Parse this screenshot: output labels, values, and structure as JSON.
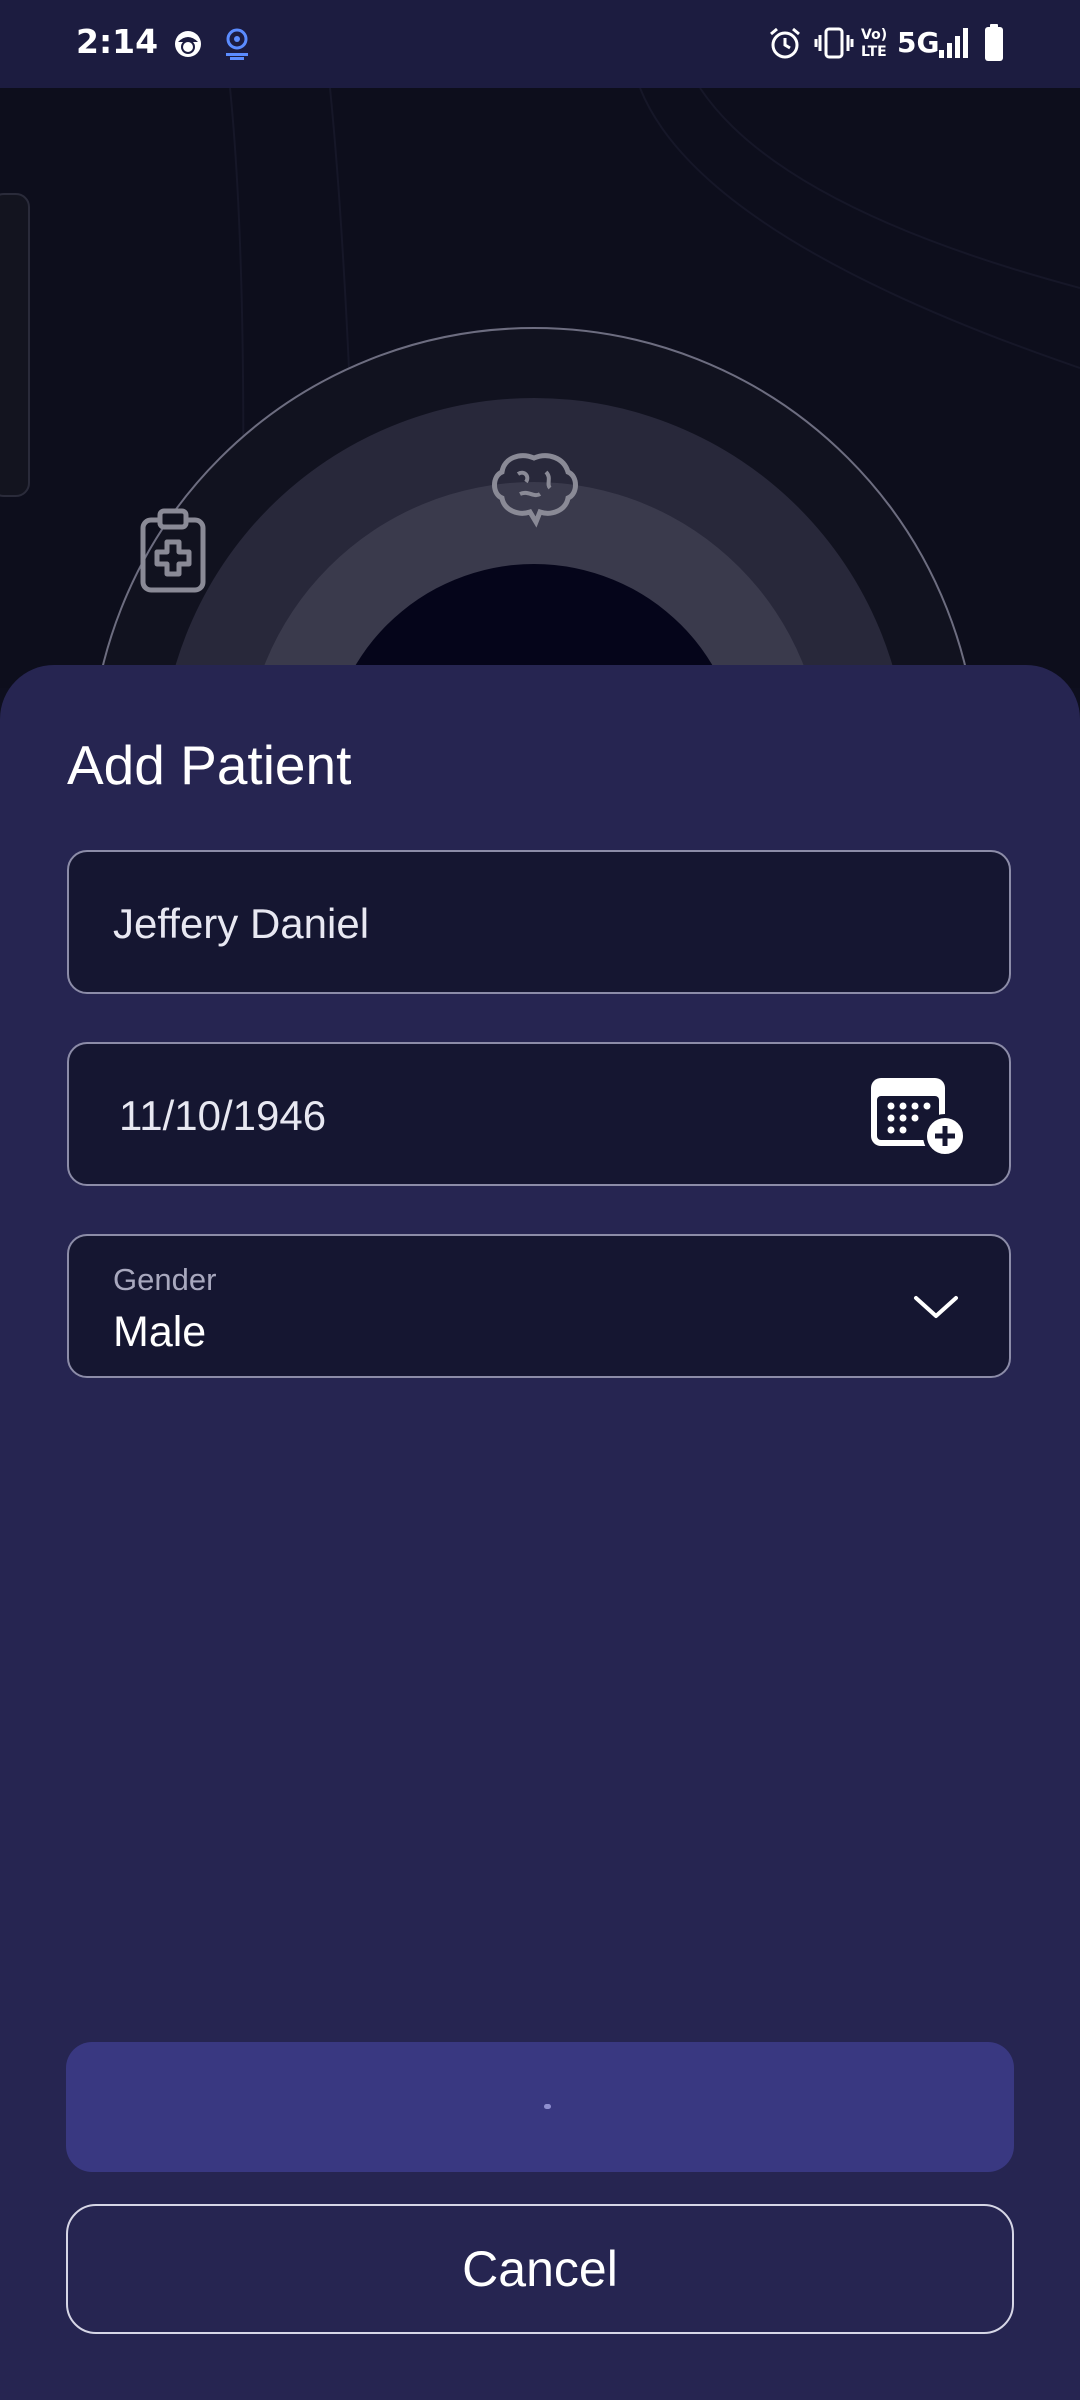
{
  "status_bar": {
    "time": "2:14",
    "network": "5G",
    "icons": [
      "face-notification-icon",
      "location-broadcast-icon",
      "alarm-icon",
      "vibrate-icon",
      "volte-icon",
      "signal-icon",
      "battery-icon"
    ]
  },
  "background": {
    "icons": [
      "clipboard-medical-icon",
      "brain-icon"
    ]
  },
  "sheet": {
    "title": "Add Patient",
    "name_field": {
      "value": "Jeffery Daniel"
    },
    "dob_field": {
      "value": "11/10/1946",
      "icon": "calendar-add-icon"
    },
    "gender_field": {
      "label": "Gender",
      "value": "Male",
      "icon": "chevron-down-icon"
    },
    "submit_button": {
      "state": "loading"
    },
    "cancel_button": {
      "label": "Cancel"
    }
  },
  "colors": {
    "status_bar": "#1c1c40",
    "sheet": "#262551",
    "field_bg": "#151631",
    "submit_button": "#393881"
  }
}
